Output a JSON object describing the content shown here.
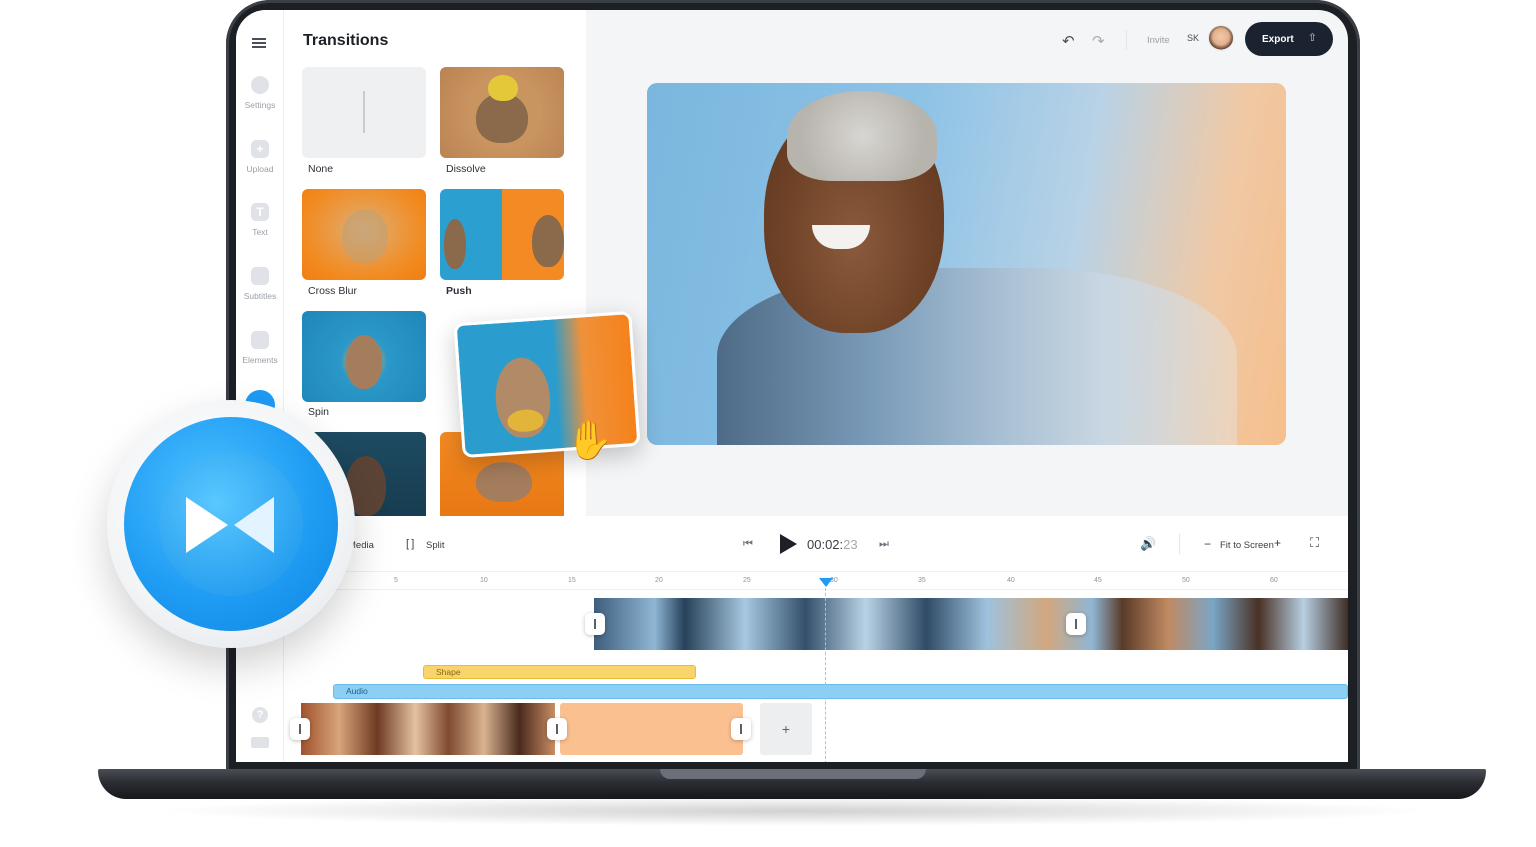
{
  "sidebar": {
    "items": [
      {
        "label": "Settings",
        "icon": "settings-icon"
      },
      {
        "label": "Upload",
        "icon": "upload-icon",
        "glyph": "+"
      },
      {
        "label": "Text",
        "icon": "text-icon",
        "glyph": "T"
      },
      {
        "label": "Subtitles",
        "icon": "subtitles-icon"
      },
      {
        "label": "Elements",
        "icon": "elements-icon"
      }
    ],
    "help_glyph": "?"
  },
  "panel": {
    "title": "Transitions",
    "thumbs": [
      {
        "label": "None"
      },
      {
        "label": "Dissolve"
      },
      {
        "label": "Cross Blur"
      },
      {
        "label": "Push"
      },
      {
        "label": "Spin"
      }
    ]
  },
  "header": {
    "invite": "Invite",
    "initials": "SK",
    "export": "Export"
  },
  "toolbar": {
    "media": "Media",
    "split": "Split",
    "time": "00:02:",
    "frames": "23",
    "fit": "Fit to Screen"
  },
  "timeline": {
    "ticks": [
      "5",
      "10",
      "15",
      "20",
      "25",
      "30",
      "35",
      "40",
      "45",
      "50",
      "60"
    ],
    "shape_label": "Shape",
    "audio_label": "Audio",
    "add_glyph": "+"
  },
  "colors": {
    "accent": "#1e9bf5",
    "export_bg": "#1b2330",
    "shape_track": "#f8d56b",
    "audio_track": "#8ccff5",
    "peach_clip": "#fbc08f"
  }
}
